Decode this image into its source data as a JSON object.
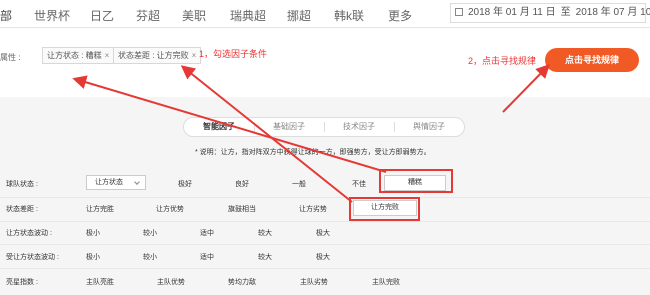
{
  "nav": {
    "items": [
      "部",
      "世界杯",
      "日乙",
      "芬超",
      "美职",
      "瑞典超",
      "挪超",
      "韩k联",
      "更多"
    ],
    "date": {
      "start": "2018 年 01 月 11 日",
      "sep": "至",
      "end": "2018 年 07 月 10 日"
    }
  },
  "filter": {
    "attr_label": "属性 :",
    "tags": [
      "让方状态 : 糟糕",
      "状态差距 : 让方完败"
    ],
    "remove_glyph": "×",
    "annotation1": "1，勾选因子条件",
    "annotation2": "2，点击寻找规律",
    "find_button": "点击寻找规律"
  },
  "tabs": [
    "智能因子",
    "基础因子",
    "技术因子",
    "舆情因子"
  ],
  "note": "* 说明：让方，指对阵双方中获得让球的一方，即强势方，受让方即弱势方。",
  "rows": [
    {
      "label": "球队状态 :",
      "select": "让方状态",
      "options": [
        "极好",
        "良好",
        "一般",
        "不佳",
        "糟糕"
      ]
    },
    {
      "label": "状态差距 :",
      "options": [
        "让方完胜",
        "让方优势",
        "旗鼓相当",
        "让方劣势",
        "让方完败"
      ]
    },
    {
      "label": "让方状态波动 :",
      "options": [
        "极小",
        "较小",
        "适中",
        "较大",
        "极大"
      ]
    },
    {
      "label": "受让方状态波动 :",
      "options": [
        "极小",
        "较小",
        "适中",
        "较大",
        "极大"
      ]
    },
    {
      "label": "亮星指数 :",
      "options": [
        "主队亮胜",
        "主队优势",
        "势均力敌",
        "主队劣势",
        "主队完败"
      ]
    }
  ],
  "colors": {
    "accent": "#f15a24",
    "annotation": "#e53935"
  }
}
